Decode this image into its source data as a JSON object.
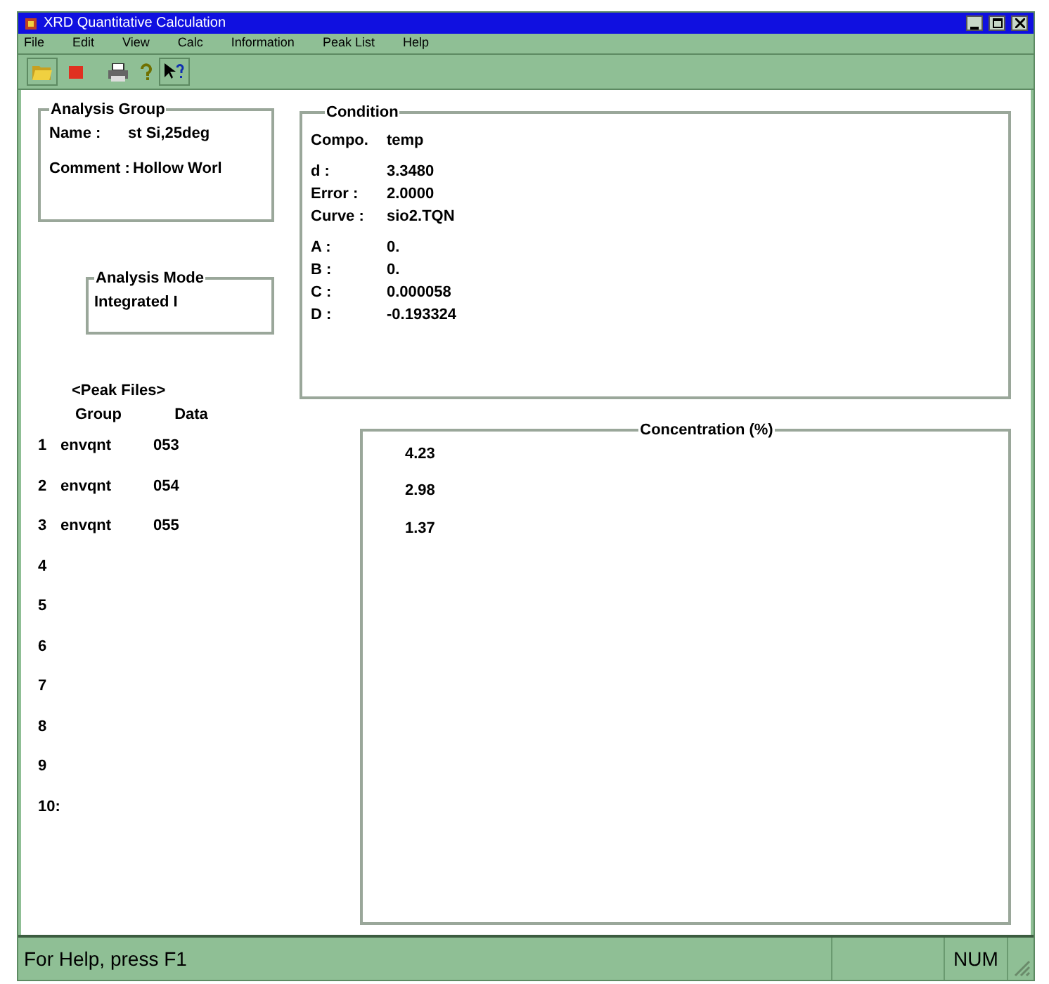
{
  "window": {
    "title": "XRD Quantitative Calculation"
  },
  "menu": [
    "File",
    "Edit",
    "View",
    "Calc",
    "Information",
    "Peak List",
    "Help"
  ],
  "analysis_group": {
    "title": "Analysis Group",
    "fields": [
      {
        "label": "Name :",
        "value": "st Si,25deg"
      },
      {
        "label": "Comment :",
        "value": "Hollow Worl"
      }
    ]
  },
  "analysis_mode": {
    "title": "Analysis Mode",
    "value": "Integrated I"
  },
  "condition": {
    "title": "Condition",
    "groups": [
      [
        {
          "label": "Compo.",
          "value": "temp"
        }
      ],
      [
        {
          "label": "d :",
          "value": "3.3480"
        },
        {
          "label": "Error :",
          "value": "2.0000"
        },
        {
          "label": "Curve :",
          "value": "sio2.TQN"
        }
      ],
      [
        {
          "label": "A :",
          "value": "0."
        },
        {
          "label": "B :",
          "value": "0."
        },
        {
          "label": "C :",
          "value": "0.000058"
        },
        {
          "label": "D :",
          "value": "-0.193324"
        }
      ]
    ]
  },
  "peak_files": {
    "title": "<Peak Files>",
    "columns": [
      "Group",
      "Data"
    ],
    "rows": [
      {
        "index": "1",
        "group": "envqnt",
        "data": "053"
      },
      {
        "index": "2",
        "group": "envqnt",
        "data": "054"
      },
      {
        "index": "3",
        "group": "envqnt",
        "data": "055"
      },
      {
        "index": "4"
      },
      {
        "index": "5"
      },
      {
        "index": "6"
      },
      {
        "index": "7"
      },
      {
        "index": "8"
      },
      {
        "index": "9"
      },
      {
        "index": "10:"
      }
    ]
  },
  "concentration": {
    "title": "Concentration (%)",
    "values": [
      "4.23",
      "2.98",
      "1.37"
    ]
  },
  "status_bar": {
    "message": "For Help, press F1",
    "indicator": "NUM"
  }
}
